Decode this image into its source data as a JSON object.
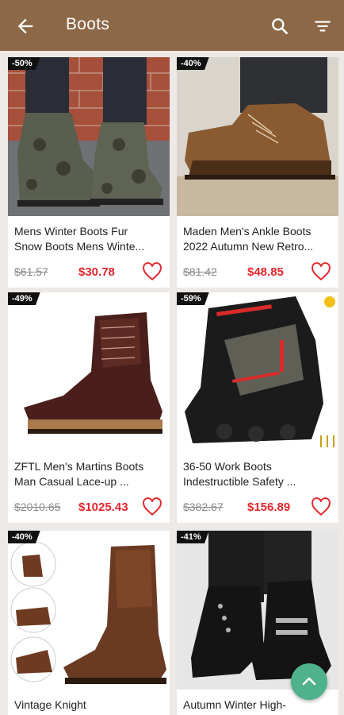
{
  "header": {
    "title": "Boots",
    "back_icon": "arrow-left-icon",
    "search_icon": "search-icon",
    "filter_icon": "filter-icon"
  },
  "products": [
    {
      "badge": "-50%",
      "name_line1": "Mens Winter Boots Fur",
      "name_line2": "Snow Boots Mens Winte...",
      "old_price": "$61.57",
      "price": "$30.78"
    },
    {
      "badge": "-40%",
      "name_line1": "Maden Men's Ankle Boots",
      "name_line2": "2022 Autumn New Retro...",
      "old_price": "$81.42",
      "price": "$48.85"
    },
    {
      "badge": "-49%",
      "name_line1": "ZFTL Men's Martins Boots",
      "name_line2": "Man Casual Lace-up ...",
      "old_price": "$2010.65",
      "price": "$1025.43"
    },
    {
      "badge": "-59%",
      "name_line1": "36-50 Work Boots",
      "name_line2": "Indestructible Safety ...",
      "old_price": "$382.67",
      "price": "$156.89"
    },
    {
      "badge": "-40%",
      "name_line1": "Vintage Knight",
      "name_line2": "",
      "old_price": "",
      "price": ""
    },
    {
      "badge": "-41%",
      "name_line1": "Autumn Winter High-",
      "name_line2": "",
      "old_price": "",
      "price": ""
    }
  ],
  "colors": {
    "header": "#8c6847",
    "price": "#e3262c",
    "fab": "#4fb28c"
  }
}
